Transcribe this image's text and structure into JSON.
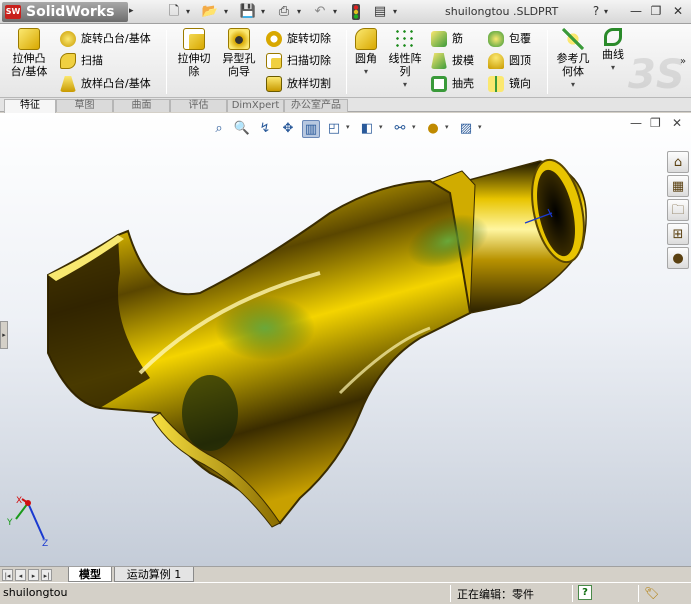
{
  "app": {
    "logo_text": "SolidWorks",
    "logo_mark": "SW",
    "document_title": "shuilongtou .SLDPRT"
  },
  "quick_toolbar": [
    {
      "name": "new-icon",
      "glyph": "▯"
    },
    {
      "name": "open-icon",
      "glyph": "📂"
    },
    {
      "name": "save-icon",
      "glyph": "💾"
    },
    {
      "name": "print-icon",
      "glyph": "⎙"
    },
    {
      "name": "undo-icon",
      "glyph": "↶"
    },
    {
      "name": "rebuild-icon",
      "glyph": "🚦"
    },
    {
      "name": "options-icon",
      "glyph": "▤"
    }
  ],
  "window_controls": {
    "help": "?",
    "minimize": "—",
    "restore": "❐",
    "close": "✕"
  },
  "commands": {
    "extrude_boss": "拉伸凸\n台/基体",
    "revolve_boss": "旋转凸台/基体",
    "sweep": "扫描",
    "loft_boss": "放样凸台/基体",
    "extrude_cut": "拉伸切\n除",
    "hole_wizard": "异型孔\n向导",
    "revolve_cut": "旋转切除",
    "sweep_cut": "扫描切除",
    "loft_cut": "放样切割",
    "fillet": "圆角",
    "linear_pattern": "线性阵\n列",
    "rib": "筋",
    "draft": "拔模",
    "shell": "抽壳",
    "wrap": "包覆",
    "dome": "圆顶",
    "mirror": "镜向",
    "ref_geometry": "参考几\n何体",
    "curves": "曲线",
    "more": "»"
  },
  "tabs": [
    "特征",
    "草图",
    "曲面",
    "评估",
    "DimXpert",
    "办公室产品"
  ],
  "active_tab": 0,
  "bottom_tabs": [
    "模型",
    "运动算例 1"
  ],
  "active_bottom_tab": 0,
  "status": {
    "filename": "shuilongtou",
    "editing": "正在编辑：零件",
    "help": "?"
  },
  "triad": {
    "x": "X",
    "y": "Y",
    "z": "Z"
  },
  "colors": {
    "gold": "#d8b000",
    "gold_dark": "#3a2c00",
    "green_reflection": "#3e7a28",
    "axis_x": "#d01010",
    "axis_y": "#1a9a1a",
    "axis_z": "#1a3ad0"
  }
}
